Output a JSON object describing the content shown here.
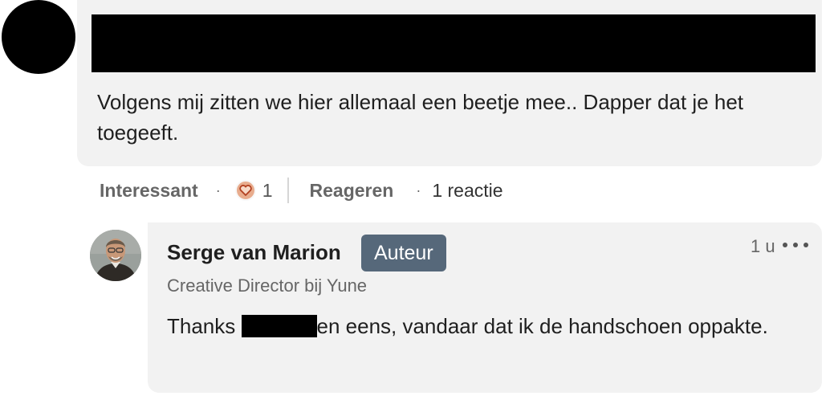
{
  "comment": {
    "text": "Volgens mij zitten we hier allemaal een beetje mee.. Dapper dat je het toegeeft.",
    "actions": {
      "like_label": "Interessant",
      "reaction_count": "1",
      "reply_label": "Reageren",
      "replies_count": "1 reactie"
    }
  },
  "reply": {
    "author": "Serge van Marion",
    "badge": "Auteur",
    "headline": "Creative Director bij Yune",
    "time": "1 u",
    "text_before": "Thanks ",
    "text_after": "en eens, vandaar dat ik de handschoen oppakte."
  },
  "colors": {
    "badge_bg": "#56687a",
    "bubble_bg": "#f2f2f2",
    "heart_bg": "#e8ac8d",
    "heart_outline": "#b24020"
  },
  "icons": {
    "reaction": "heart-icon",
    "more": "ellipsis-icon"
  }
}
